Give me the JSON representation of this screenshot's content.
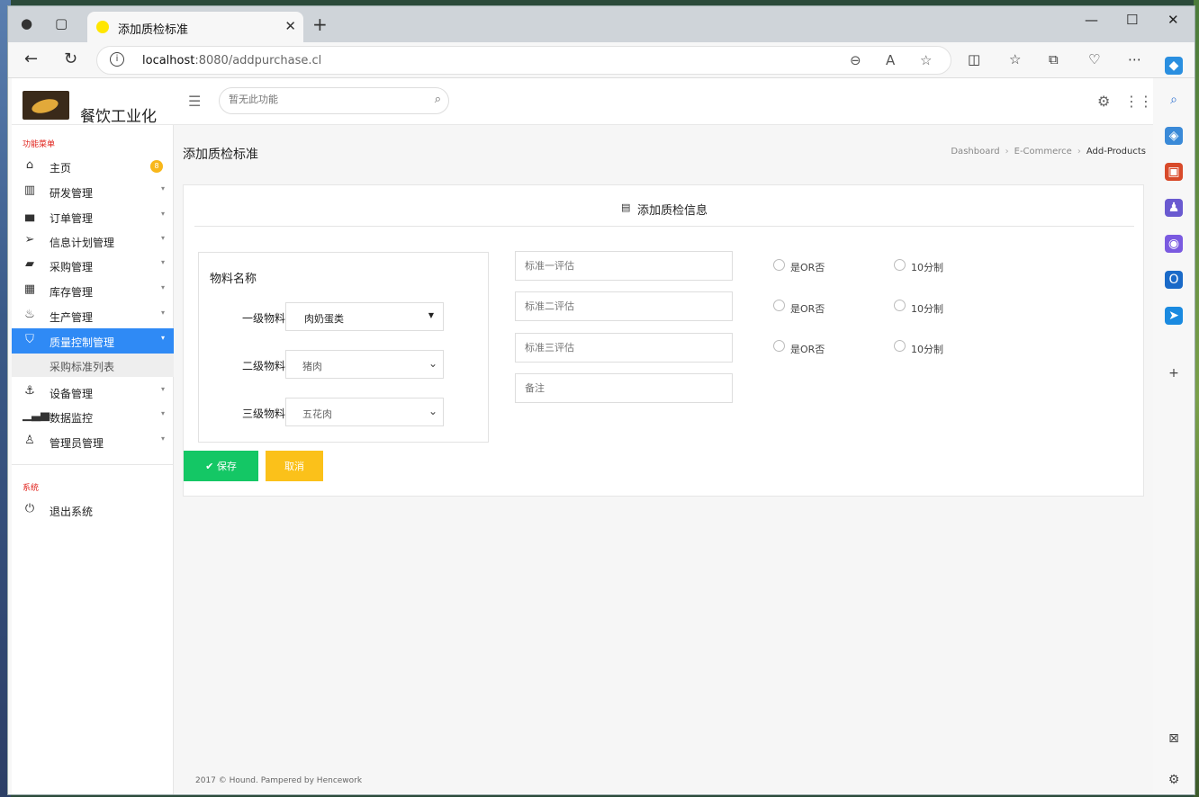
{
  "browser": {
    "tab_title": "添加质检标准",
    "url_host": "localhost",
    "url_rest": ":8080/addpurchase.cl"
  },
  "app": {
    "brand": "餐饮工业化",
    "search_placeholder": "暂无此功能"
  },
  "sidebar": {
    "section_menu": "功能菜单",
    "section_system": "系统",
    "items": [
      {
        "label": "主页",
        "icon": "home-icon",
        "badge": "8"
      },
      {
        "label": "研发管理",
        "icon": "book-icon"
      },
      {
        "label": "订单管理",
        "icon": "cart-icon"
      },
      {
        "label": "信息计划管理",
        "icon": "paper-plane-icon"
      },
      {
        "label": "采购管理",
        "icon": "truck-icon"
      },
      {
        "label": "库存管理",
        "icon": "grid-icon"
      },
      {
        "label": "生产管理",
        "icon": "flame-icon"
      },
      {
        "label": "质量控制管理",
        "icon": "html5-icon"
      },
      {
        "label": "设备管理",
        "icon": "anchor-icon"
      },
      {
        "label": "数据监控",
        "icon": "signal-icon"
      },
      {
        "label": "管理员管理",
        "icon": "user-icon"
      }
    ],
    "sub_item": "采购标准列表",
    "logout": "退出系统"
  },
  "page": {
    "title": "添加质检标准",
    "breadcrumb": [
      "Dashboard",
      "E-Commerce",
      "Add-Products"
    ]
  },
  "form": {
    "card_title": "添加质检信息",
    "material_title": "物料名称",
    "levels": [
      {
        "label": "一级物料",
        "value": "肉奶蛋类"
      },
      {
        "label": "二级物料",
        "value": "猪肉"
      },
      {
        "label": "三级物料",
        "value": "五花肉"
      }
    ],
    "criteria_placeholders": [
      "标准一评估",
      "标准二评估",
      "标准三评估"
    ],
    "note_placeholder": "备注",
    "radio_yes_no": "是OR否",
    "radio_ten": "10分制",
    "save": "保存",
    "cancel": "取消"
  },
  "footer": "2017 © Hound. Pampered by Hencework",
  "colors": {
    "active_menu": "#2f8af5",
    "save_button": "#14c765",
    "cancel_button": "#fbc11a",
    "section_title": "#e0201a"
  }
}
